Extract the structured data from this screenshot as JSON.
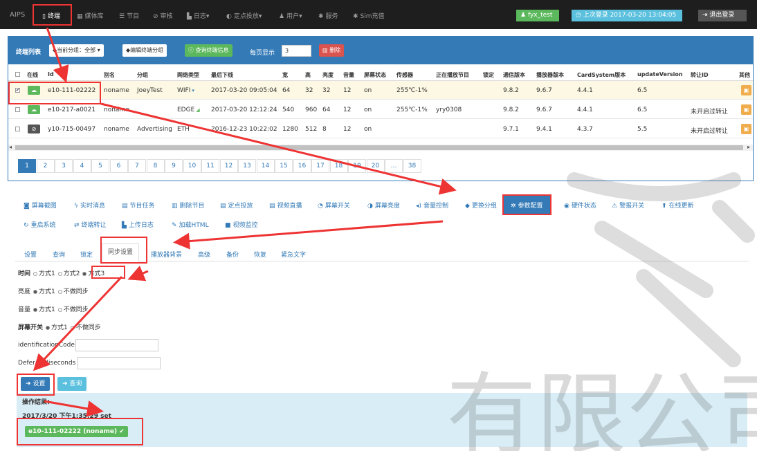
{
  "nav": {
    "brand": "AIPS",
    "items": [
      {
        "label": "终端",
        "icon": "▯"
      },
      {
        "label": "媒体库",
        "icon": "▦"
      },
      {
        "label": "节目",
        "icon": "☰"
      },
      {
        "label": "审核",
        "icon": "⊘"
      },
      {
        "label": "日志▾",
        "icon": "▙"
      },
      {
        "label": "定点投放▾",
        "icon": "◐"
      },
      {
        "label": "用户▾",
        "icon": "♟"
      },
      {
        "label": "服务",
        "icon": "✱"
      },
      {
        "label": "Sim充值",
        "icon": "✱"
      }
    ],
    "user": "fyx_test",
    "last_login": "上次登录 2017-03-20 13:04:05",
    "logout": "退出登录"
  },
  "toolbar": {
    "title": "终端列表",
    "group_filter": "当前分组：全部 ▾",
    "edit_group": "编辑终端分组",
    "query_info": "查询终端信息",
    "per_page_label": "每页显示",
    "per_page_value": "3",
    "delete": "删除"
  },
  "table": {
    "headers": [
      "在线",
      "Id",
      "别名",
      "分组",
      "网络类型",
      "最后下线",
      "宽",
      "高",
      "亮度",
      "音量",
      "屏幕状态",
      "传感器",
      "正在播放节目",
      "锁定",
      "通信版本",
      "播放器版本",
      "CardSystem版本",
      "updateVersion",
      "转让ID",
      "其他"
    ],
    "rows": [
      {
        "checked": "✔",
        "online": "☁",
        "id": "e10-111-02222",
        "alias": "noname",
        "group": "JoeyTest",
        "net": "WIFI",
        "net_icon": "▾",
        "last_off": "2017-03-20 09:05:04",
        "w": "64",
        "h": "32",
        "bright": "32",
        "vol": "12",
        "screen": "on",
        "sensor": "255℃-1%",
        "playing": "",
        "lock": "",
        "comm": "9.8.2",
        "player": "9.6.7",
        "card": "4.4.1",
        "upd": "6.5",
        "transfer": "",
        "status_color": "#5cb85c"
      },
      {
        "checked": "",
        "online": "☁",
        "id": "e10-217-a0021",
        "alias": "noname",
        "group": "",
        "net": "EDGE",
        "net_icon": "◢",
        "last_off": "2017-03-20 12:12:24",
        "w": "540",
        "h": "960",
        "bright": "64",
        "vol": "12",
        "screen": "on",
        "sensor": "255℃-1%",
        "playing": "yry0308",
        "lock": "",
        "comm": "9.8.2",
        "player": "9.6.7",
        "card": "4.4.1",
        "upd": "6.5",
        "transfer": "未开启过转让",
        "status_color": "#5cb85c"
      },
      {
        "checked": "",
        "online": "⊘",
        "id": "y10-715-00497",
        "alias": "noname",
        "group": "Advertising",
        "net": "ETH",
        "net_icon": "",
        "last_off": "2016-12-23 10:22:02",
        "w": "1280",
        "h": "512",
        "bright": "8",
        "vol": "12",
        "screen": "on",
        "sensor": "",
        "playing": "",
        "lock": "",
        "comm": "9.7.1",
        "player": "9.4.1",
        "card": "4.3.7",
        "upd": "5.5",
        "transfer": "未开启过转让",
        "status_color": "#555555"
      }
    ],
    "edit_icon": "▣"
  },
  "pagination": [
    "1",
    "2",
    "3",
    "4",
    "5",
    "6",
    "7",
    "8",
    "9",
    "10",
    "11",
    "12",
    "13",
    "14",
    "15",
    "16",
    "17",
    "18",
    "19",
    "20",
    "…",
    "38"
  ],
  "actions": [
    {
      "label": "屏幕截图",
      "icon": "◙"
    },
    {
      "label": "实时消息",
      "icon": "ϟ"
    },
    {
      "label": "节目任务",
      "icon": "▤"
    },
    {
      "label": "删除节目",
      "icon": "▥"
    },
    {
      "label": "定点投放",
      "icon": "▤"
    },
    {
      "label": "视频直播",
      "icon": "▤"
    },
    {
      "label": "屏幕开关",
      "icon": "◔"
    },
    {
      "label": "屏幕亮度",
      "icon": "◑"
    },
    {
      "label": "音量控制",
      "icon": "◂)"
    },
    {
      "label": "更换分组",
      "icon": "◆"
    },
    {
      "label": "参数配置",
      "icon": "✲"
    },
    {
      "label": "硬件状态",
      "icon": "◉"
    },
    {
      "label": "警报开关",
      "icon": "⚠"
    },
    {
      "label": "在线更新",
      "icon": "⬆"
    },
    {
      "label": "重启系统",
      "icon": "↻"
    },
    {
      "label": "终端转让",
      "icon": "⇄"
    },
    {
      "label": "上传日志",
      "icon": "▙"
    },
    {
      "label": "加载HTML",
      "icon": "✎"
    },
    {
      "label": "视频监控",
      "icon": "■"
    }
  ],
  "tabs": [
    "设置",
    "查询",
    "锁定",
    "同步设置",
    "播放器背景",
    "高级",
    "备份",
    "恢复",
    "紧急文字"
  ],
  "form": {
    "time_label": "时间",
    "opt1": "方式1",
    "opt2": "方式2",
    "opt3": "方式3",
    "brightness_label": "亮度",
    "volume_label": "音量",
    "screen_label": "屏幕开关",
    "no_sync": "不做同步",
    "identification_label": "identificationCode",
    "defer_label": "Defer milliseconds",
    "set_btn": "设置",
    "query_btn": "查询"
  },
  "result": {
    "title": "操作结果：",
    "time": "2017/3/20 下午1:35:29 set",
    "badge": "e10-111-02222 (noname) ✔"
  },
  "watermark": "有限公司"
}
